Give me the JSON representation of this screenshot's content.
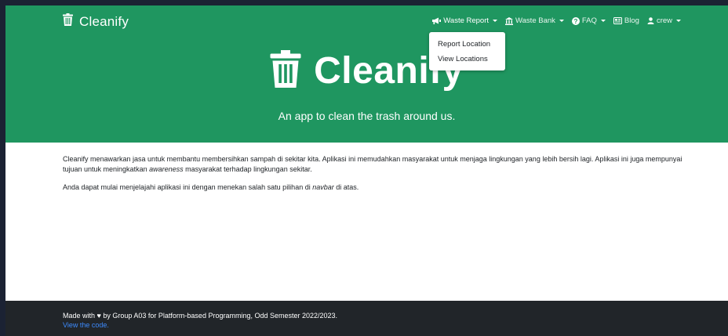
{
  "brand": {
    "name": "Cleanify",
    "icon": "trash-icon"
  },
  "nav": {
    "items": [
      {
        "label": "Waste Report",
        "icon": "megaphone-icon",
        "has_caret": true
      },
      {
        "label": "Waste Bank",
        "icon": "bank-icon",
        "has_caret": true
      },
      {
        "label": "FAQ",
        "icon": "question-circle-icon",
        "has_caret": true
      },
      {
        "label": "Blog",
        "icon": "newspaper-icon",
        "has_caret": false
      },
      {
        "label": "crew",
        "icon": "user-icon",
        "has_caret": true
      }
    ],
    "dropdown": {
      "items": [
        "Report Location",
        "View Locations"
      ]
    }
  },
  "hero": {
    "title": "Cleanify",
    "subtitle": "An app to clean the trash around us."
  },
  "content": {
    "p1_a": "Cleanify menawarkan jasa untuk membantu membersihkan sampah di sekitar kita. Aplikasi ini memudahkan masyarakat untuk menjaga lingkungan yang lebih bersih lagi. Aplikasi ini juga mempunyai tujuan untuk meningkatkan ",
    "p1_em": "awareness",
    "p1_b": " masyarakat terhadap lingkungan sekitar.",
    "p2_a": "Anda dapat mulai menjelajahi aplikasi ini dengan menekan salah satu pilihan di ",
    "p2_em": "navbar",
    "p2_b": " di atas."
  },
  "footer": {
    "text_a": "Made with ",
    "heart": "♥",
    "text_b": " by Group A03 for Platform-based Programming, Odd Semester 2022/2023.",
    "link": "View the code."
  },
  "colors": {
    "primary_green": "#1f9660",
    "footer_bg": "#212529",
    "link_blue": "#3d8bfd",
    "frame": "#1b2233"
  }
}
